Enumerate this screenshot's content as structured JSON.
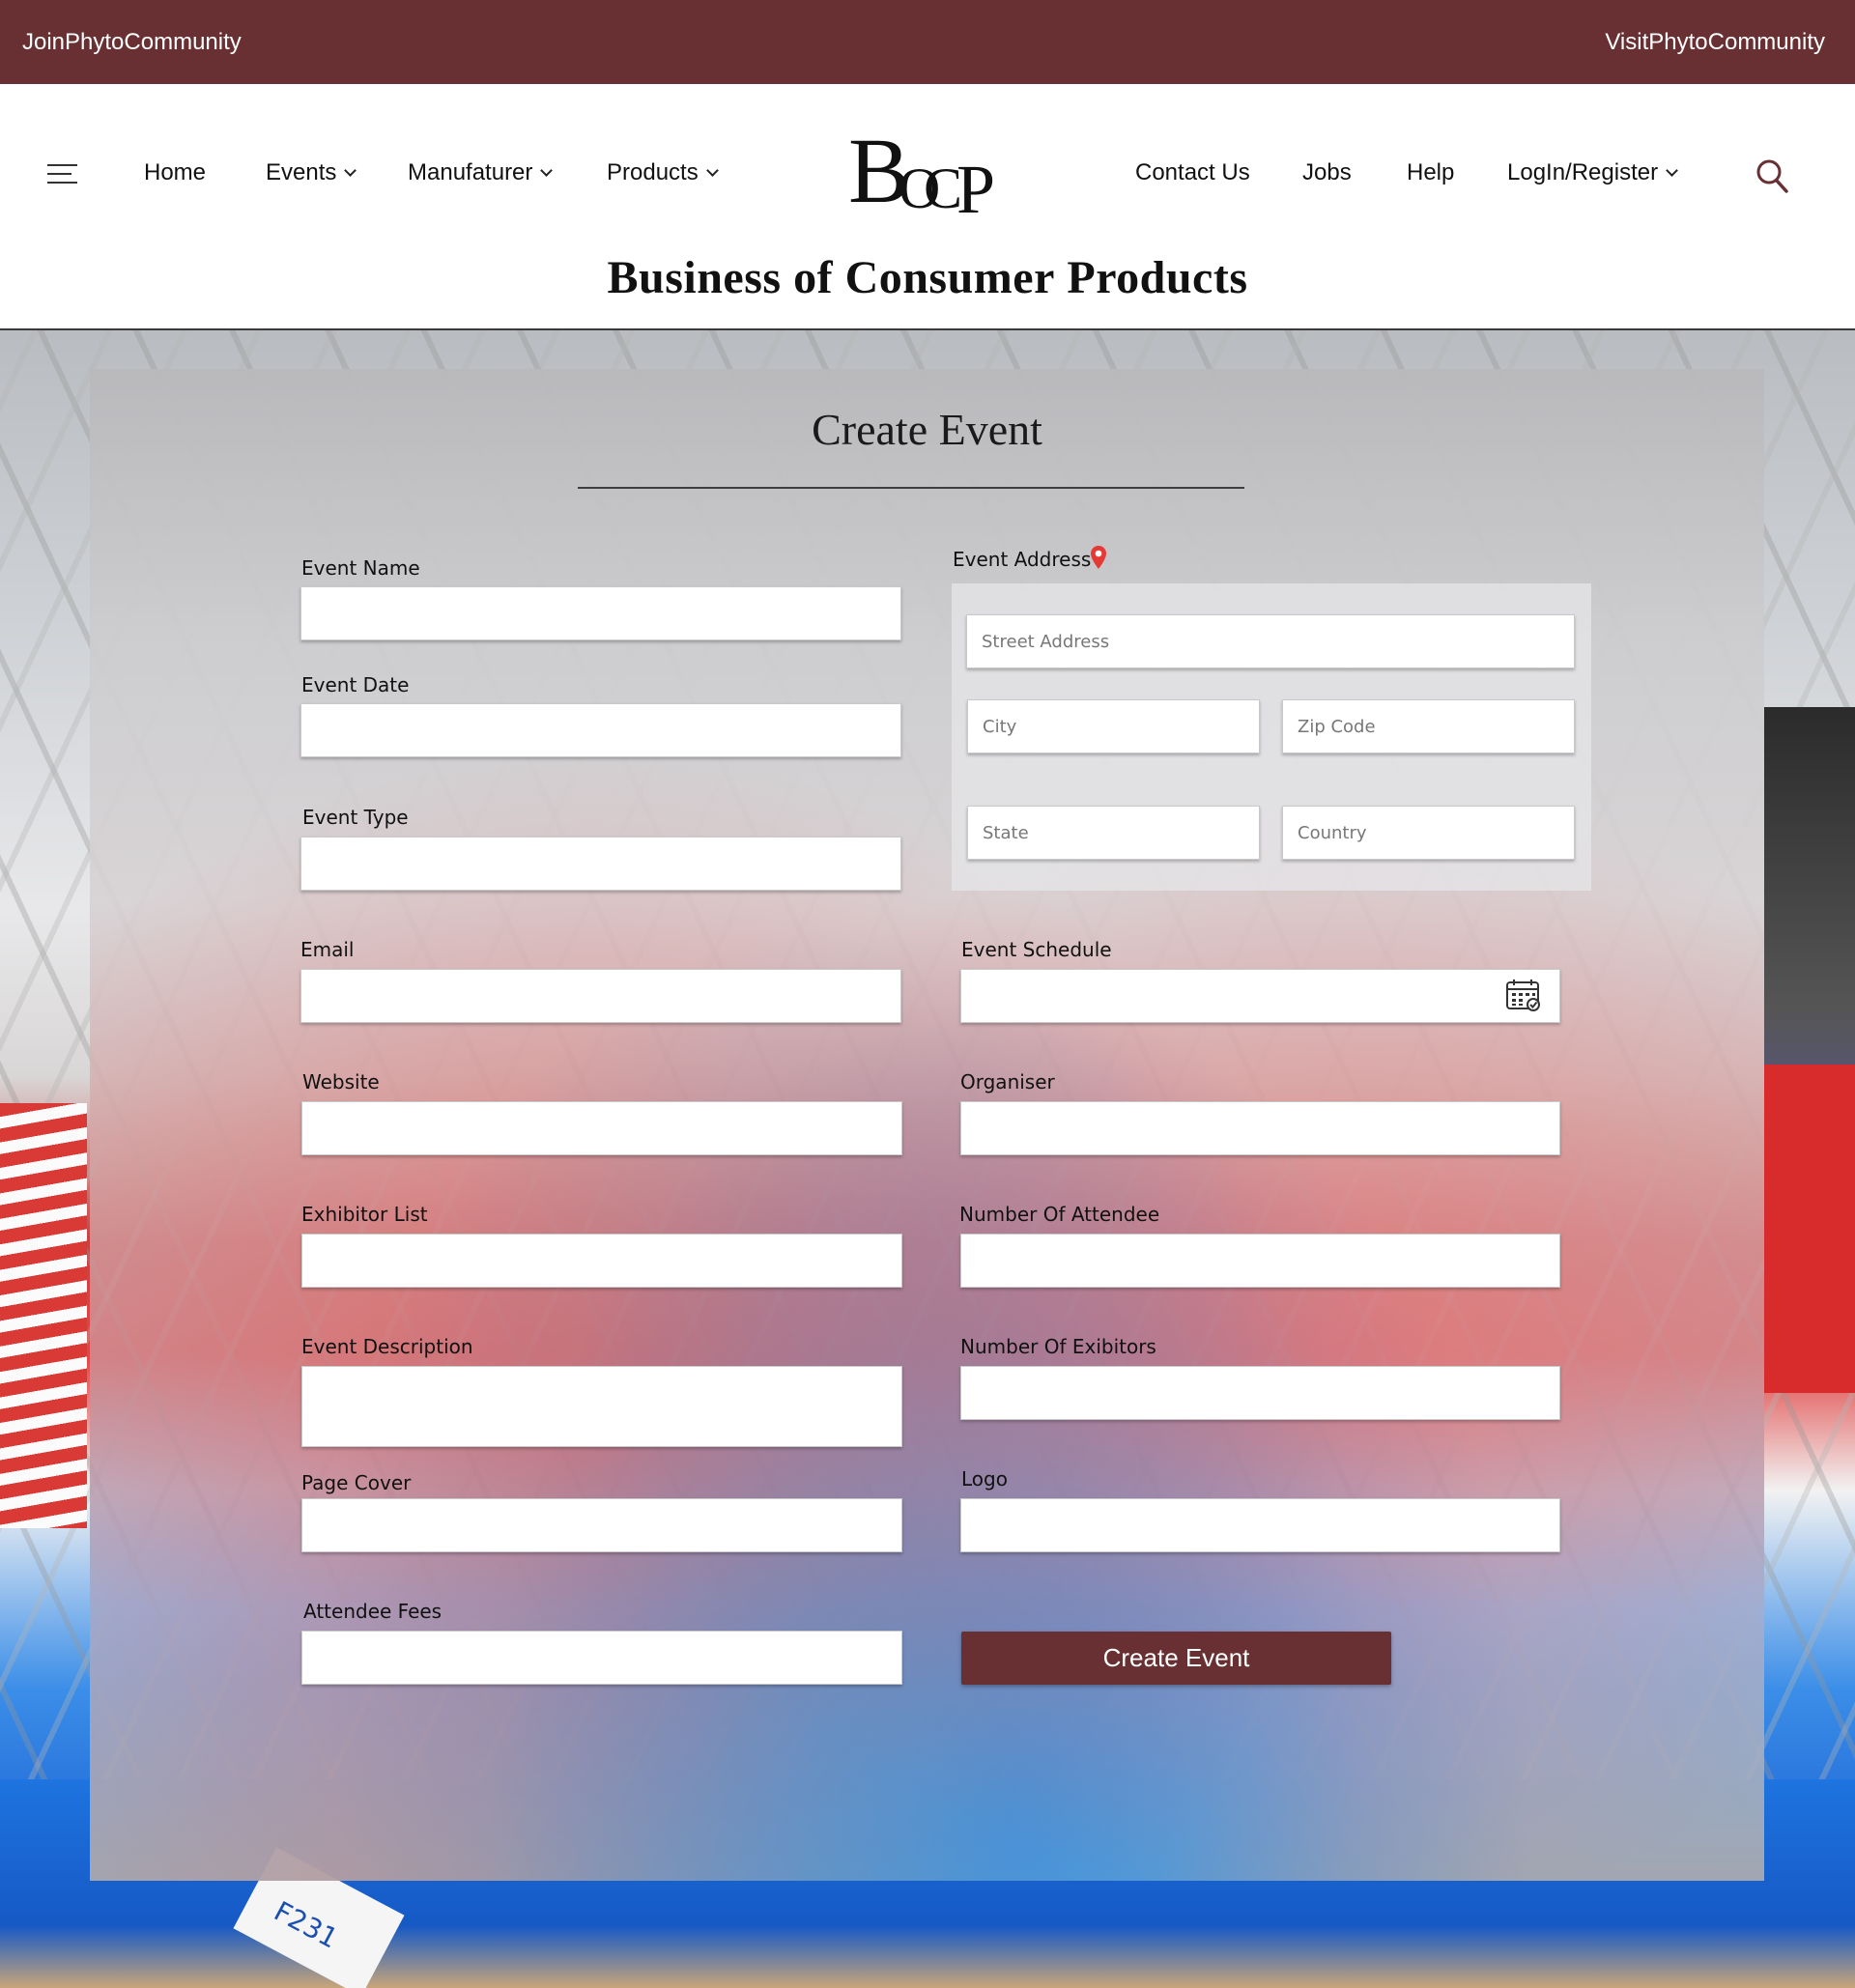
{
  "topbar": {
    "left_link": "JoinPhytoCommunity",
    "right_link": "VisitPhytoCommunity"
  },
  "nav": {
    "items": [
      {
        "label": "Home",
        "dropdown": false
      },
      {
        "label": "Events",
        "dropdown": true
      },
      {
        "label": "Manufaturer",
        "dropdown": true
      },
      {
        "label": "Products",
        "dropdown": true
      },
      {
        "label": "Contact Us",
        "dropdown": false
      },
      {
        "label": "Jobs",
        "dropdown": false
      },
      {
        "label": "Help",
        "dropdown": false
      },
      {
        "label": "LogIn/Register",
        "dropdown": true
      }
    ]
  },
  "logo": {
    "b": "B",
    "o": "O",
    "c": "C",
    "p": "P"
  },
  "tagline": {
    "w1": "Business",
    "w2": "of",
    "w3": "Consumer",
    "w4": "Products"
  },
  "form": {
    "title": "Create Event",
    "fields": {
      "event_name": {
        "label": "Event Name",
        "value": "",
        "placeholder": ""
      },
      "event_date": {
        "label": "Event Date",
        "value": "",
        "placeholder": ""
      },
      "event_type": {
        "label": "Event Type",
        "value": "",
        "placeholder": ""
      },
      "email": {
        "label": "Email",
        "value": "",
        "placeholder": ""
      },
      "website": {
        "label": "Website",
        "value": "",
        "placeholder": ""
      },
      "exhibitor_list": {
        "label": "Exhibitor List",
        "value": "",
        "placeholder": ""
      },
      "event_description": {
        "label": "Event Description",
        "value": "",
        "placeholder": ""
      },
      "page_cover": {
        "label": "Page Cover",
        "value": "",
        "placeholder": ""
      },
      "attendee_fees": {
        "label": "Attendee Fees",
        "value": "",
        "placeholder": ""
      },
      "event_schedule": {
        "label": "Event Schedule",
        "value": "",
        "placeholder": ""
      },
      "organiser": {
        "label": "Organiser",
        "value": "",
        "placeholder": ""
      },
      "number_of_attendee": {
        "label": "Number Of Attendee",
        "value": "",
        "placeholder": ""
      },
      "number_of_exibitors": {
        "label": "Number Of Exibitors",
        "value": "",
        "placeholder": ""
      },
      "logo": {
        "label": "Logo",
        "value": "",
        "placeholder": ""
      }
    },
    "address": {
      "label": "Event Address",
      "street_placeholder": "Street Address",
      "city_placeholder": "City",
      "zip_placeholder": "Zip Code",
      "state_placeholder": "State",
      "country_placeholder": "Country"
    },
    "submit_label": "Create Event"
  },
  "icons": {
    "menu": "hamburger-menu-icon",
    "search": "search-icon",
    "location": "map-pin-icon",
    "calendar": "calendar-icon"
  },
  "colors": {
    "brand": "#693033",
    "pin": "#e53935"
  },
  "background": {
    "booth_sign": "F231"
  }
}
